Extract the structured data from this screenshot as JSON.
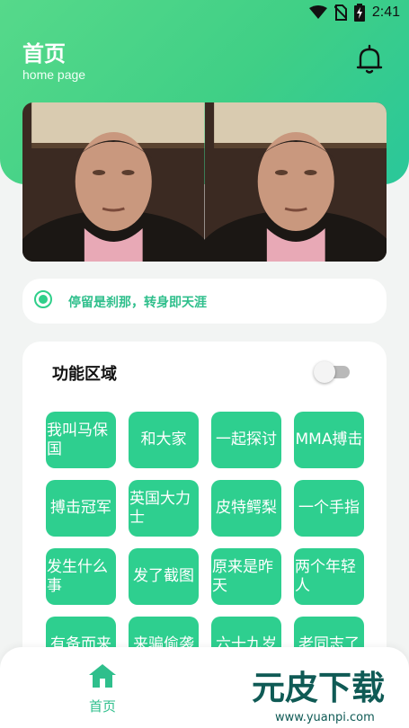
{
  "status_bar": {
    "time": "2:41"
  },
  "header": {
    "title": "首页",
    "subtitle": "home page",
    "bell_icon": "bell-icon"
  },
  "notice": {
    "text": "停留是刹那，转身即天涯"
  },
  "panel": {
    "title": "功能区域",
    "toggle_on": false,
    "tiles": [
      "我叫马保国",
      "和大家",
      "一起探讨",
      "MMA搏击",
      "搏击冠军",
      "英国大力士",
      "皮特鳄梨",
      "一个手指",
      "发生什么事",
      "发了截图",
      "原来是昨天",
      "两个年轻人",
      "有备而来",
      "来骗偷袭",
      "六十九岁",
      "老同志了"
    ]
  },
  "tabbar": {
    "home_label": "首页",
    "home_icon": "home-icon"
  },
  "watermark": {
    "brand": "元皮下载",
    "url": "www.yuanpi.com"
  },
  "colors": {
    "accent": "#2ecf8f",
    "accent_text": "#2fbf8c",
    "background": "#f2f4f3"
  }
}
